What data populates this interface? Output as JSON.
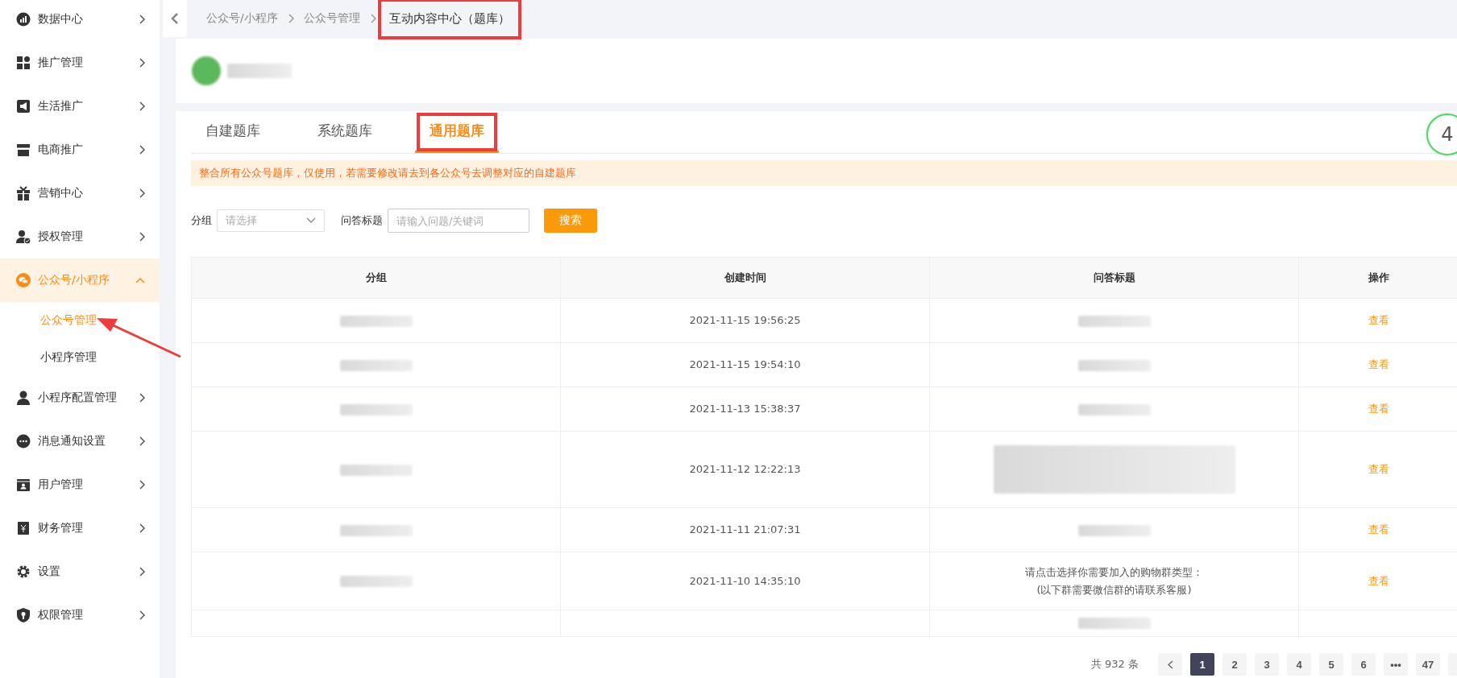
{
  "sidebar": {
    "items": [
      {
        "label": "数据中心",
        "expanded": false,
        "selected": false
      },
      {
        "label": "推广管理",
        "expanded": false,
        "selected": false
      },
      {
        "label": "生活推广",
        "expanded": false,
        "selected": false
      },
      {
        "label": "电商推广",
        "expanded": false,
        "selected": false
      },
      {
        "label": "营销中心",
        "expanded": false,
        "selected": false
      },
      {
        "label": "授权管理",
        "expanded": false,
        "selected": false
      },
      {
        "label": "公众号/小程序",
        "expanded": true,
        "selected": true,
        "children": [
          {
            "label": "公众号管理",
            "selected": true,
            "pointed": true
          },
          {
            "label": "小程序管理",
            "selected": false,
            "pointed": false
          }
        ]
      },
      {
        "label": "小程序配置管理",
        "expanded": false,
        "selected": false
      },
      {
        "label": "消息通知设置",
        "expanded": false,
        "selected": false
      },
      {
        "label": "用户管理",
        "expanded": false,
        "selected": false
      },
      {
        "label": "财务管理",
        "expanded": false,
        "selected": false
      },
      {
        "label": "设置",
        "expanded": false,
        "selected": false
      },
      {
        "label": "权限管理",
        "expanded": false,
        "selected": false
      }
    ]
  },
  "breadcrumb": [
    {
      "label": "公众号/小程序",
      "current": false,
      "highlighted": false
    },
    {
      "label": "公众号管理",
      "current": false,
      "highlighted": false
    },
    {
      "label": "互动内容中心（题库）",
      "current": true,
      "highlighted": true
    }
  ],
  "tabs": [
    {
      "label": "自建题库",
      "selected": false,
      "highlighted": false
    },
    {
      "label": "系统题库",
      "selected": false,
      "highlighted": false
    },
    {
      "label": "通用题库",
      "selected": true,
      "highlighted": true
    }
  ],
  "float_badge": {
    "text": "4"
  },
  "notice": "整合所有公众号题库，仅使用，若需要修改请去到各公众号去调整对应的自建题库",
  "filters": {
    "group": {
      "label": "分组",
      "placeholder": "请选择"
    },
    "title": {
      "label": "问答标题",
      "placeholder": "请输入问题/关键词"
    },
    "search_button": "搜索"
  },
  "table": {
    "columns": [
      "分组",
      "创建时间",
      "问答标题",
      "操作"
    ],
    "rows": [
      {
        "cells": [
          {
            "kind": "redacted"
          },
          {
            "kind": "text",
            "text": "2021-11-15 19:56:25"
          },
          {
            "kind": "redacted"
          },
          {
            "kind": "link",
            "text": "查看"
          }
        ]
      },
      {
        "cells": [
          {
            "kind": "redacted"
          },
          {
            "kind": "text",
            "text": "2021-11-15 19:54:10"
          },
          {
            "kind": "redacted"
          },
          {
            "kind": "link",
            "text": "查看"
          }
        ]
      },
      {
        "cells": [
          {
            "kind": "redacted"
          },
          {
            "kind": "text",
            "text": "2021-11-13 15:38:37"
          },
          {
            "kind": "redacted"
          },
          {
            "kind": "link",
            "text": "查看"
          }
        ]
      },
      {
        "cells": [
          {
            "kind": "redacted"
          },
          {
            "kind": "text",
            "text": "2021-11-12 12:22:13"
          },
          {
            "kind": "redacted_para"
          },
          {
            "kind": "link",
            "text": "查看"
          }
        ]
      },
      {
        "cells": [
          {
            "kind": "redacted"
          },
          {
            "kind": "text",
            "text": "2021-11-11 21:07:31"
          },
          {
            "kind": "redacted"
          },
          {
            "kind": "link",
            "text": "查看"
          }
        ]
      },
      {
        "cells": [
          {
            "kind": "redacted"
          },
          {
            "kind": "text",
            "text": "2021-11-10 14:35:10"
          },
          {
            "kind": "text",
            "text": "请点击选择你需要加入的购物群类型：\n(以下群需要微信群的请联系客服)"
          },
          {
            "kind": "link",
            "text": "查看"
          }
        ]
      },
      {
        "cells": [
          {
            "kind": "empty"
          },
          {
            "kind": "empty"
          },
          {
            "kind": "redacted"
          },
          {
            "kind": "empty"
          }
        ]
      }
    ]
  },
  "pagination": {
    "total": "共 932 条",
    "pages": [
      {
        "label": "1",
        "selected": true
      },
      {
        "label": "2",
        "selected": false
      },
      {
        "label": "3",
        "selected": false
      },
      {
        "label": "4",
        "selected": false
      },
      {
        "label": "5",
        "selected": false
      },
      {
        "label": "6",
        "selected": false
      },
      {
        "label": "•••",
        "selected": false
      },
      {
        "label": "47",
        "selected": false
      }
    ]
  }
}
